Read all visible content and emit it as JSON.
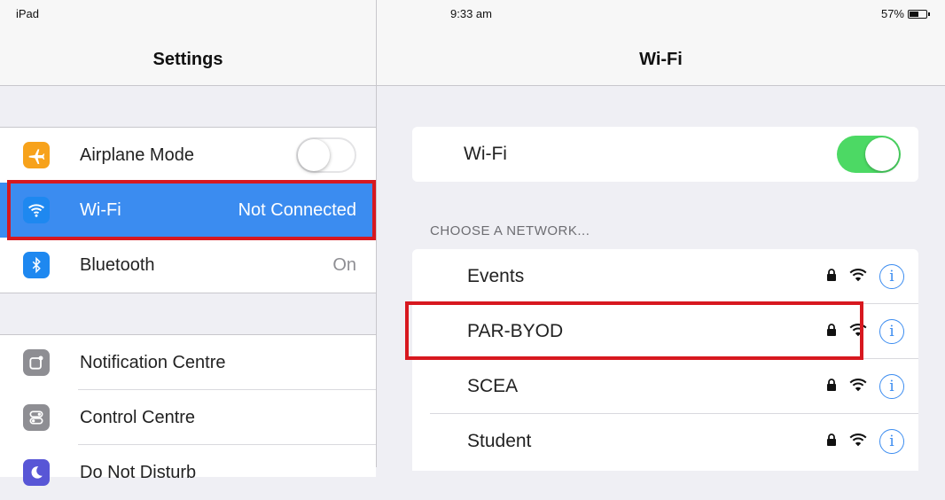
{
  "status_bar": {
    "device": "iPad",
    "time": "9:33 am",
    "battery": "57%"
  },
  "left_pane": {
    "title": "Settings",
    "items": [
      {
        "label": "Airplane Mode",
        "icon": "airplane-icon",
        "color": "#f7a21b",
        "toggle": "off"
      },
      {
        "label": "Wi-Fi",
        "value": "Not Connected",
        "icon": "wifi-icon",
        "color": "#1e88f0",
        "selected": true
      },
      {
        "label": "Bluetooth",
        "value": "On",
        "icon": "bluetooth-icon",
        "color": "#1e88f0"
      },
      {
        "label": "Notification Centre",
        "icon": "notification-centre-icon",
        "color": "#8e8e93"
      },
      {
        "label": "Control Centre",
        "icon": "control-centre-icon",
        "color": "#8e8e93"
      },
      {
        "label": "Do Not Disturb",
        "icon": "moon-icon",
        "color": "#5856d6"
      }
    ]
  },
  "right_pane": {
    "title": "Wi-Fi",
    "wifi_toggle_label": "Wi-Fi",
    "wifi_toggle": "on",
    "section_header": "CHOOSE A NETWORK...",
    "networks": [
      {
        "name": "Events",
        "secured": true
      },
      {
        "name": "PAR-BYOD",
        "secured": true,
        "highlighted": true
      },
      {
        "name": "SCEA",
        "secured": true
      },
      {
        "name": "Student",
        "secured": true
      }
    ]
  },
  "colors": {
    "accent": "#3b8cf0",
    "toggle_on": "#4cd964",
    "highlight": "#d7181f"
  }
}
